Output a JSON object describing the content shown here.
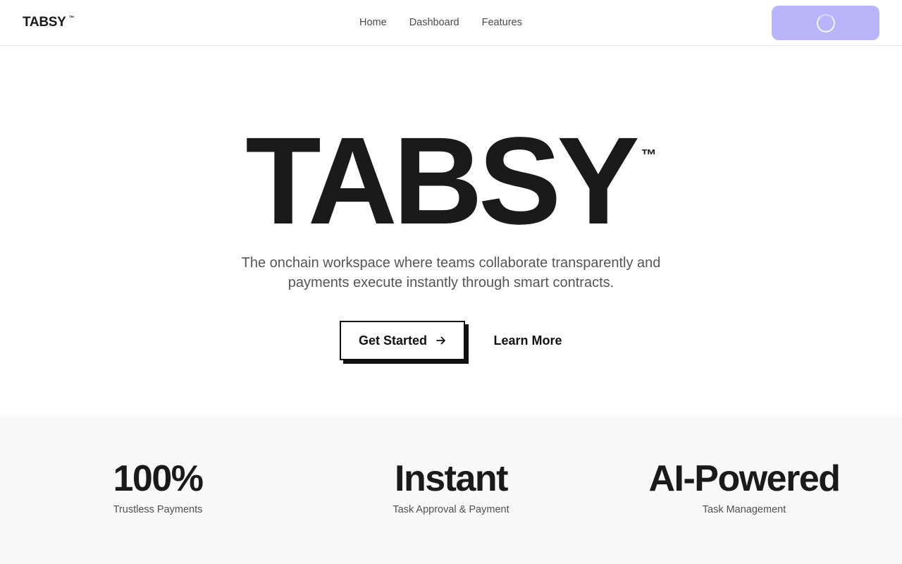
{
  "header": {
    "brand": "TABSY",
    "brand_tm": "™",
    "nav": [
      {
        "label": "Home"
      },
      {
        "label": "Dashboard"
      },
      {
        "label": "Features"
      }
    ],
    "connect_button": {
      "state": "loading",
      "icon": "spinner-icon",
      "color": "#b8b5fb"
    }
  },
  "hero": {
    "title": "TABSY",
    "title_tm": "™",
    "subtitle": "The onchain workspace where teams collaborate transparently and payments execute instantly through smart contracts.",
    "primary_cta": {
      "label": "Get Started",
      "icon": "arrow-right-icon"
    },
    "secondary_cta": {
      "label": "Learn More"
    }
  },
  "stats": [
    {
      "value": "100%",
      "label": "Trustless Payments"
    },
    {
      "value": "Instant",
      "label": "Task Approval & Payment"
    },
    {
      "value": "AI-Powered",
      "label": "Task Management"
    }
  ],
  "colors": {
    "text": "#1a1a1a",
    "muted": "#555555",
    "accent": "#b8b5fb",
    "stats_bg": "#f9f9f9"
  }
}
